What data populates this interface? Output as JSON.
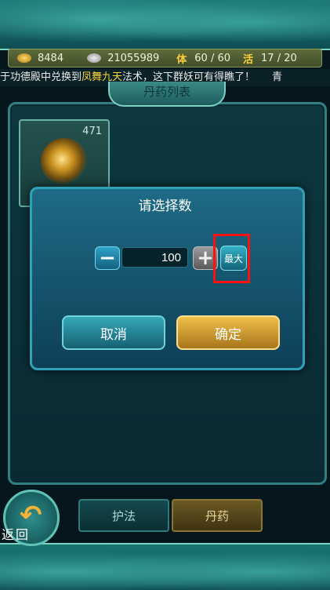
{
  "resources": {
    "gold": "8484",
    "silver": "21055989",
    "stamina_label": "体",
    "stamina": "60 / 60",
    "activity_label": "活",
    "activity": "17 / 20"
  },
  "marquee": {
    "prefix": "于功德殿中兑换到",
    "highlight": "凤舞九天",
    "suffix": "法术，这下群妖可有得瞧了！",
    "tail": "青"
  },
  "panel": {
    "title": "丹药列表"
  },
  "item": {
    "count": "471"
  },
  "dialog": {
    "title": "请选择数",
    "quantity": "100",
    "minus_symbol": "−",
    "plus_symbol": "+",
    "max_label": "最大",
    "cancel_label": "取消",
    "confirm_label": "确定"
  },
  "footer": {
    "back_label": "返回",
    "tabs": [
      "护法",
      "丹药"
    ]
  },
  "colors": {
    "highlight": "#ff1010",
    "confirm": "#f0c04a",
    "cancel": "#35a8b8"
  },
  "icons": {
    "gold": "gold-ingot-icon",
    "silver": "silver-ingot-icon",
    "back": "back-arrow-icon"
  }
}
